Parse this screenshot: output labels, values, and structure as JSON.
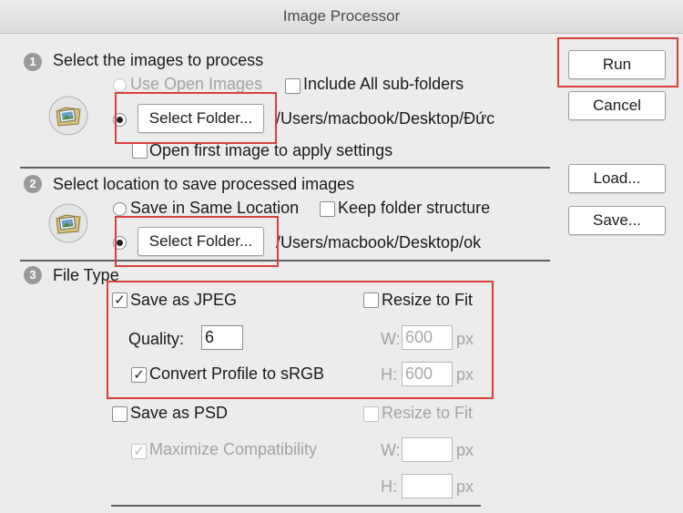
{
  "window": {
    "title": "Image Processor"
  },
  "steps": [
    "1",
    "2",
    "3"
  ],
  "section1": {
    "heading": "Select the images to process",
    "use_open_images": "Use Open Images",
    "include_subfolders": "Include All sub-folders",
    "select_folder": "Select Folder...",
    "source_path": "/Users/macbook/Desktop/Đức",
    "open_first_image": "Open first image to apply settings",
    "icon": "folder-with-photo-icon"
  },
  "section2": {
    "heading": "Select location to save processed images",
    "save_same_location": "Save in Same Location",
    "keep_structure": "Keep folder structure",
    "select_folder": "Select Folder...",
    "dest_path": "/Users/macbook/Desktop/ok",
    "icon": "folder-with-photo-icon"
  },
  "section3": {
    "heading": "File Type",
    "jpeg": {
      "label": "Save as JPEG",
      "checked": true,
      "resize": "Resize to Fit",
      "quality_label": "Quality:",
      "quality_value": "6",
      "w_label": "W:",
      "w_value": "600",
      "h_label": "H:",
      "h_value": "600",
      "px": "px",
      "convert_profile": "Convert Profile to sRGB"
    },
    "psd": {
      "label": "Save as PSD",
      "resize": "Resize to Fit",
      "max_compat": "Maximize Compatibility",
      "w_label": "W:",
      "h_label": "H:",
      "px": "px"
    }
  },
  "buttons": {
    "run": "Run",
    "cancel": "Cancel",
    "load": "Load...",
    "save": "Save..."
  },
  "colors": {
    "highlight": "#d9403a",
    "background": "#ececec"
  }
}
